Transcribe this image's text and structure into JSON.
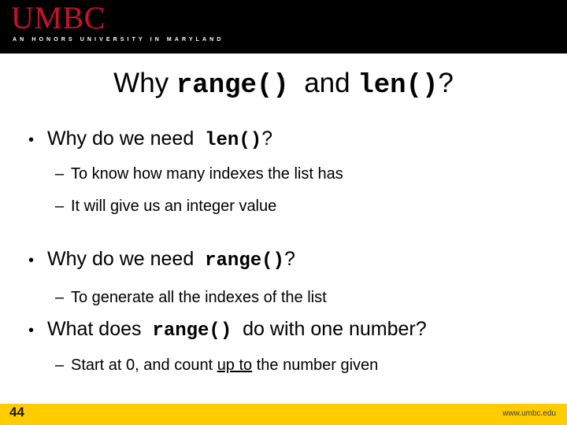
{
  "header": {
    "logo_wordmark": "UMBC",
    "logo_tagline": "AN HONORS UNIVERSITY IN MARYLAND",
    "band_color": "#000000",
    "logo_color": "#c8102e"
  },
  "title": {
    "part1": "Why",
    "code1": "range()",
    "part2": "and",
    "code2": "len()",
    "part3": "?"
  },
  "bullets": [
    {
      "level": 1,
      "marker": "•",
      "text_before": "Why do we need",
      "code": "len()",
      "text_after": "?"
    },
    {
      "level": 2,
      "marker": "–",
      "text": "To know how many indexes the list has"
    },
    {
      "level": 2,
      "marker": "–",
      "text": "It will give us an integer value"
    },
    {
      "level": 1,
      "marker": "•",
      "text_before": "Why do we need",
      "code": "range()",
      "text_after": "?"
    },
    {
      "level": 2,
      "marker": "–",
      "text": "To generate all the indexes of the list"
    },
    {
      "level": 1,
      "marker": "•",
      "text_before": "What does",
      "code": "range()",
      "text_after": "do with one number?"
    },
    {
      "level": 2,
      "marker": "–",
      "text_before": "Start at 0, and count",
      "underlined": "up to",
      "text_after": "the number given"
    }
  ],
  "footer": {
    "slide_number": "44",
    "url": "www.umbc.edu",
    "band_color": "#ffcc00"
  }
}
